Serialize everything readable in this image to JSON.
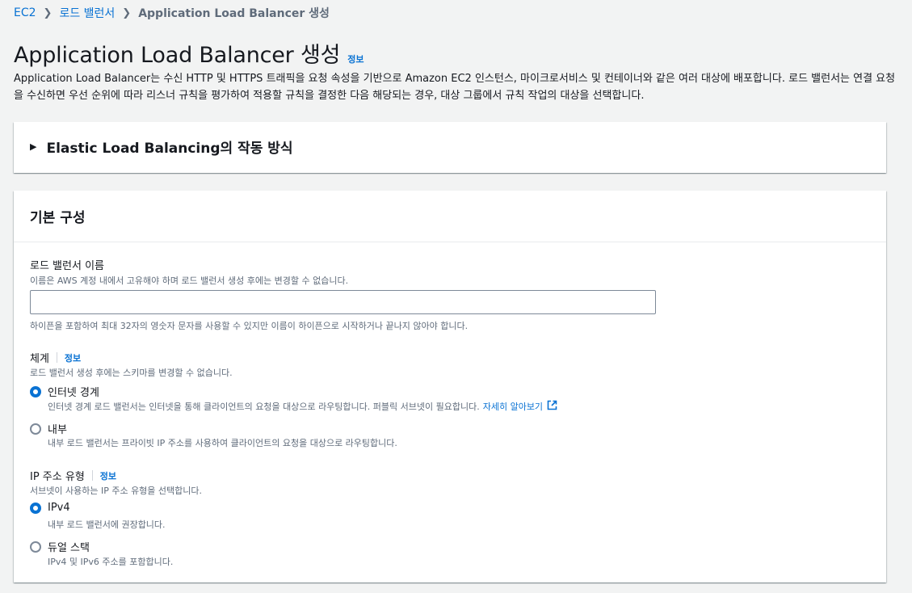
{
  "breadcrumb": {
    "items": [
      "EC2",
      "로드 밸런서"
    ],
    "current": "Application Load Balancer 생성"
  },
  "header": {
    "title": "Application Load Balancer 생성",
    "info": "정보",
    "description": "Application Load Balancer는 수신 HTTP 및 HTTPS 트래픽을 요청 속성을 기반으로 Amazon EC2 인스턴스, 마이크로서비스 및 컨테이너와 같은 여러 대상에 배포합니다. 로드 밸런서는 연결 요청을 수신하면 우선 순위에 따라 리스너 규칙을 평가하여 적용할 규칙을 결정한 다음 해당되는 경우, 대상 그룹에서 규칙 작업의 대상을 선택합니다."
  },
  "how_it_works": {
    "title": "Elastic Load Balancing의 작동 방식"
  },
  "basic_config": {
    "title": "기본 구성",
    "name_field": {
      "label": "로드 밸런서 이름",
      "description": "이름은 AWS 계정 내에서 고유해야 하며 로드 밸런서 생성 후에는 변경할 수 없습니다.",
      "value": "",
      "constraint": "하이픈을 포함하여 최대 32자의 영숫자 문자를 사용할 수 있지만 이름이 하이픈으로 시작하거나 끝나지 않아야 합니다."
    },
    "scheme": {
      "label": "체계",
      "info": "정보",
      "description": "로드 밸런서 생성 후에는 스키마를 변경할 수 없습니다.",
      "options": [
        {
          "label": "인터넷 경계",
          "description": "인터넷 경계 로드 밸런서는 인터넷을 통해 클라이언트의 요청을 대상으로 라우팅합니다. 퍼블릭 서브넷이 필요합니다.",
          "link": "자세히 알아보기",
          "selected": true
        },
        {
          "label": "내부",
          "description": "내부 로드 밸런서는 프라이빗 IP 주소를 사용하여 클라이언트의 요청을 대상으로 라우팅합니다.",
          "selected": false
        }
      ]
    },
    "ip_type": {
      "label": "IP 주소 유형",
      "info": "정보",
      "description": "서브넷이 사용하는 IP 주소 유형을 선택합니다.",
      "options": [
        {
          "label": "IPv4",
          "description": "내부 로드 밸런서에 권장합니다.",
          "selected": true
        },
        {
          "label": "듀얼 스택",
          "description": "IPv4 및 IPv6 주소를 포함합니다.",
          "selected": false
        }
      ]
    }
  },
  "colors": {
    "link": "#0972d3",
    "background": "#f2f3f3",
    "text": "#16191f",
    "muted": "#5f6b7a"
  }
}
